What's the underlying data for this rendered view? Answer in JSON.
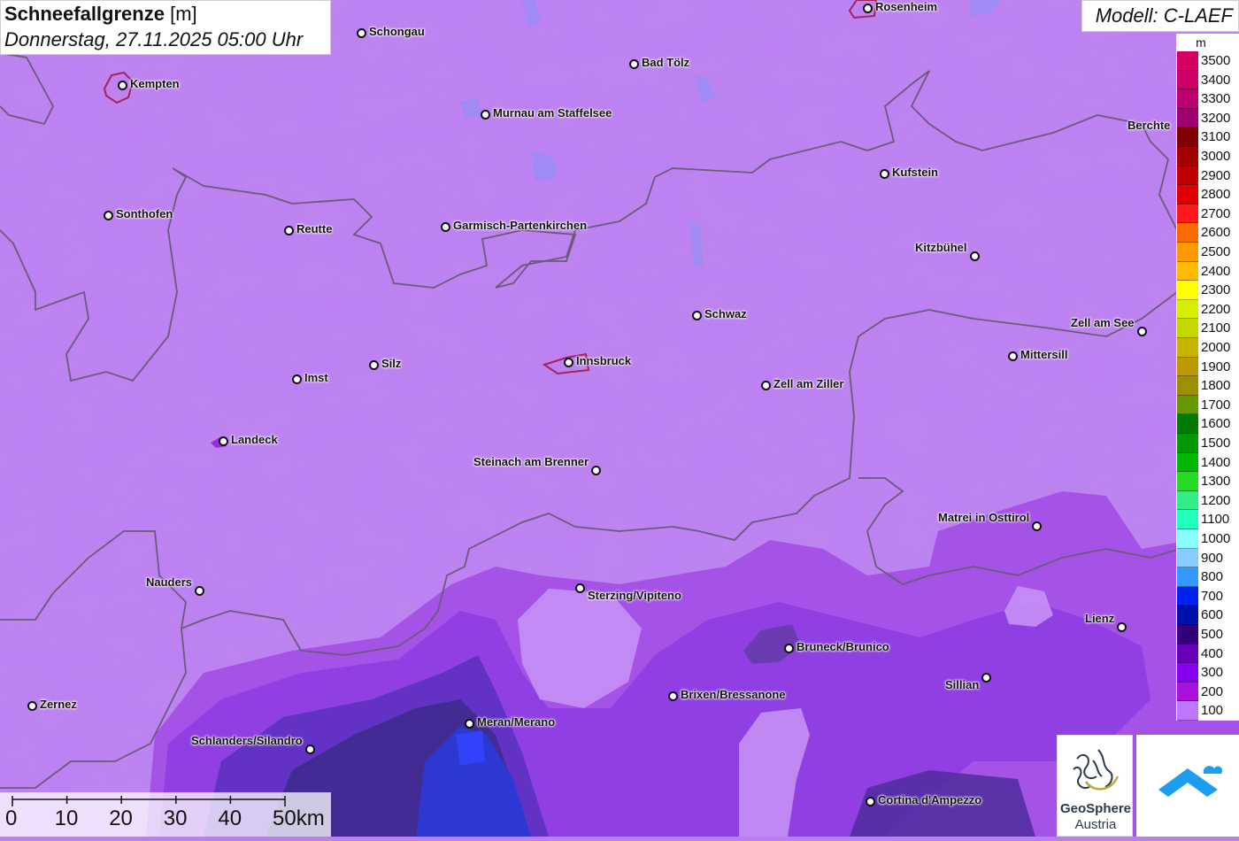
{
  "title": {
    "parameter": "Schneefallgrenze",
    "unit": "[m]",
    "datetime": "Donnerstag, 27.11.2025 05:00 Uhr"
  },
  "model": "Modell: C-LAEF",
  "legend": {
    "unit": "m",
    "levels": [
      {
        "label": "3500",
        "color": "#d5005f"
      },
      {
        "label": "3400",
        "color": "#cc0066"
      },
      {
        "label": "3300",
        "color": "#bb0070"
      },
      {
        "label": "3200",
        "color": "#a00070"
      },
      {
        "label": "3100",
        "color": "#800000"
      },
      {
        "label": "3000",
        "color": "#a00000"
      },
      {
        "label": "2900",
        "color": "#c00000"
      },
      {
        "label": "2800",
        "color": "#e00000"
      },
      {
        "label": "2700",
        "color": "#ff1a1a"
      },
      {
        "label": "2600",
        "color": "#ff6a00"
      },
      {
        "label": "2500",
        "color": "#ff9900"
      },
      {
        "label": "2400",
        "color": "#ffbb00"
      },
      {
        "label": "2300",
        "color": "#ffff00"
      },
      {
        "label": "2200",
        "color": "#d4f000"
      },
      {
        "label": "2100",
        "color": "#c4d800"
      },
      {
        "label": "2000",
        "color": "#c8b400"
      },
      {
        "label": "1900",
        "color": "#bb9a00"
      },
      {
        "label": "1800",
        "color": "#9a9000"
      },
      {
        "label": "1700",
        "color": "#669900"
      },
      {
        "label": "1600",
        "color": "#007a00"
      },
      {
        "label": "1500",
        "color": "#009900"
      },
      {
        "label": "1400",
        "color": "#00b800"
      },
      {
        "label": "1300",
        "color": "#22dd22"
      },
      {
        "label": "1200",
        "color": "#33ee88"
      },
      {
        "label": "1100",
        "color": "#22ffbb"
      },
      {
        "label": "1000",
        "color": "#88ffff"
      },
      {
        "label": "900",
        "color": "#88ccff"
      },
      {
        "label": "800",
        "color": "#3399ff"
      },
      {
        "label": "700",
        "color": "#0022ee"
      },
      {
        "label": "600",
        "color": "#0011aa"
      },
      {
        "label": "500",
        "color": "#330077"
      },
      {
        "label": "400",
        "color": "#6600bb"
      },
      {
        "label": "300",
        "color": "#8800ee"
      },
      {
        "label": "200",
        "color": "#aa11dd"
      },
      {
        "label": "100",
        "color": "#bb77ff"
      }
    ]
  },
  "cities": [
    {
      "name": "Rosenheim"
    },
    {
      "name": "Schongau"
    },
    {
      "name": "Bad Tölz"
    },
    {
      "name": "Kempten"
    },
    {
      "name": "Murnau am Staffelsee"
    },
    {
      "name": "Berchte"
    },
    {
      "name": "Kufstein"
    },
    {
      "name": "Sonthofen"
    },
    {
      "name": "Reutte"
    },
    {
      "name": "Garmisch-Partenkirchen"
    },
    {
      "name": "Kitzbühel"
    },
    {
      "name": "Schwaz"
    },
    {
      "name": "Zell am See"
    },
    {
      "name": "Mittersill"
    },
    {
      "name": "Innsbruck"
    },
    {
      "name": "Silz"
    },
    {
      "name": "Imst"
    },
    {
      "name": "Zell am Ziller"
    },
    {
      "name": "Landeck"
    },
    {
      "name": "Steinach am Brenner"
    },
    {
      "name": "Matrei in Osttirol"
    },
    {
      "name": "Nauders"
    },
    {
      "name": "Sterzing/Vipiteno"
    },
    {
      "name": "Lienz"
    },
    {
      "name": "Bruneck/Brunico"
    },
    {
      "name": "Sillian"
    },
    {
      "name": "Brixen/Bressanone"
    },
    {
      "name": "Zernez"
    },
    {
      "name": "Meran/Merano"
    },
    {
      "name": "Schlanders/Silandro"
    },
    {
      "name": "Cortina d'Ampezzo"
    }
  ],
  "scale_bar": {
    "ticks": [
      "0",
      "10",
      "20",
      "30",
      "40",
      "50km"
    ]
  },
  "logos": {
    "geosphere_line1": "GeoSphere",
    "geosphere_line2": "Austria"
  }
}
